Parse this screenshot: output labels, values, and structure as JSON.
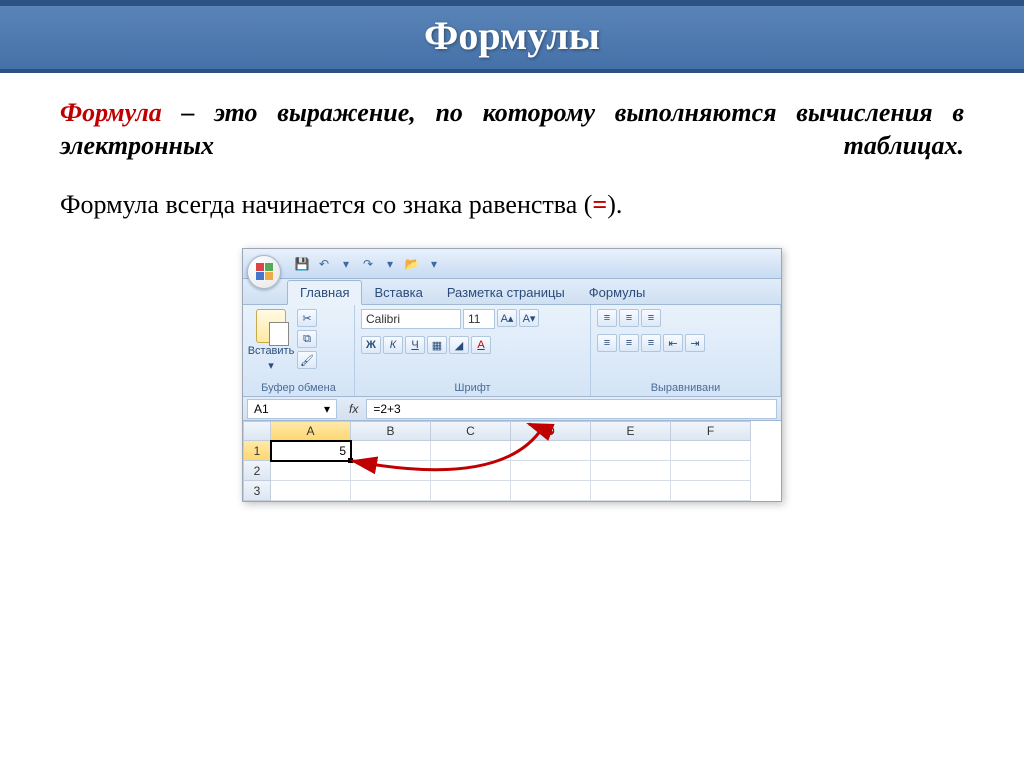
{
  "slide": {
    "title": "Формулы",
    "definition_term": "Формула",
    "definition_rest": " – это выражение, по которому выполняются вычисления в электронных таблицах.",
    "subline_before": "Формула всегда начинается со знака равенства (",
    "subline_eq": "=",
    "subline_after": ")."
  },
  "excel": {
    "qat": {
      "save": "💾",
      "undo": "↶",
      "redo": "↷",
      "open": "📂",
      "dd": "▾"
    },
    "tabs": {
      "home": "Главная",
      "insert": "Вставка",
      "layout": "Разметка страницы",
      "formulas": "Формулы"
    },
    "ribbon": {
      "paste_label": "Вставить",
      "clipboard_group": "Буфер обмена",
      "font_name": "Calibri",
      "font_size": "11",
      "font_group": "Шрифт",
      "align_group": "Выравнивани",
      "bold": "Ж",
      "italic": "К",
      "underline": "Ч"
    },
    "fbar": {
      "name": "A1",
      "fx": "fx",
      "formula": "=2+3"
    },
    "grid": {
      "cols": [
        "A",
        "B",
        "C",
        "D",
        "E",
        "F"
      ],
      "rows": [
        "1",
        "2",
        "3"
      ],
      "a1_value": "5"
    }
  }
}
